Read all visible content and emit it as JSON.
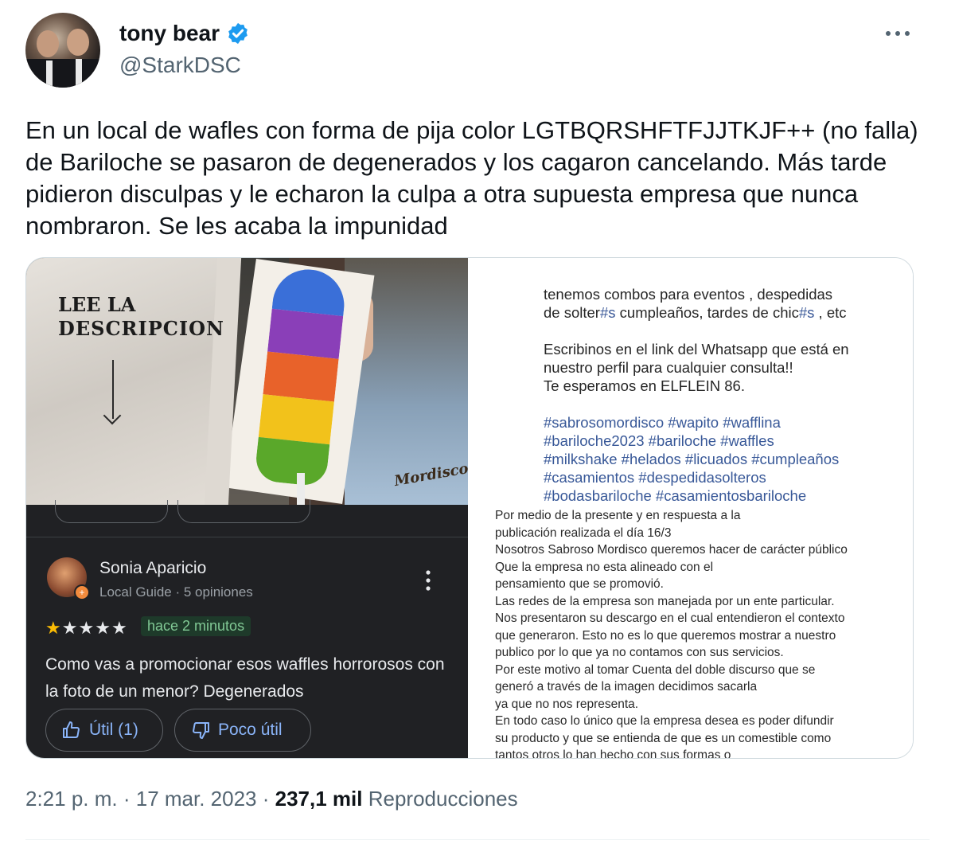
{
  "author": {
    "name": "tony bear",
    "handle": "@StarkDSC",
    "verified": true,
    "verified_color": "#1d9bf0"
  },
  "more_icon": "more-horizontal-icon",
  "tweet_text": "En un local de wafles con forma de pija color LGTBQRSHFTFJJTKJF++ (no falla) de Bariloche se pasaron de degenerados y los cagaron cancelando. Más tarde pidieron disculpas y le echaron la culpa a otra supuesta empresa que nunca nombraron. Se les acaba la impunidad",
  "photo": {
    "line1": "LEE LA",
    "line2": "DESCRIPCION",
    "brand": "Mordisco",
    "rainbow_colors": [
      "#3a6fd8",
      "#8a3fb8",
      "#e8622a",
      "#f2c21b",
      "#5aa82a"
    ]
  },
  "review": {
    "reviewer_name": "Sonia Aparicio",
    "reviewer_sub": "Local Guide · 5 opiniones",
    "stars_filled": 1,
    "stars_total": 5,
    "time": "hace 2 minutos",
    "text": "Como vas a promocionar esos waffles horrorosos con la foto de un menor? Degenerados",
    "useful_label": "Útil (1)",
    "not_useful_label": "Poco útil"
  },
  "post": {
    "line1": "tenemos combos para eventos , despedidas",
    "line2_a": "de solter",
    "line2_b": "#s",
    "line2_c": " cumpleaños, tardes de chic",
    "line2_d": "#s",
    "line2_e": " , etc",
    "line3": "Escribinos en el link del Whatsapp que está en",
    "line4": "nuestro perfil para cualquier consulta!!",
    "line5": "Te esperamos en ELFLEIN 86.",
    "tags": [
      "#sabrosomordisco #wapito #wafflina",
      "#bariloche2023 #bariloche #waffles",
      "#milkshake #helados #licuados #cumpleaños",
      "#casamientos #despedidasolteros",
      "#bodasbariloche #casamientosbariloche"
    ]
  },
  "letter_lines": [
    "Por medio de la presente y en respuesta a la",
    "publicación realizada el día 16/3",
    "Nosotros Sabroso Mordisco queremos hacer de carácter público",
    "Que la empresa no esta alineado con el",
    "pensamiento que se promovió.",
    "Las redes de la empresa son manejada por un ente particular.",
    "Nos presentaron su descargo en el cual entendieron el contexto",
    "que generaron. Esto no es lo que queremos mostrar a nuestro",
    "publico por lo que ya no contamos con sus servicios.",
    "Por este motivo al tomar Cuenta del doble discurso que se",
    "generó a través de la imagen decidimos sacarla",
    "ya que no nos representa.",
    "En todo caso lo único que la empresa desea es poder difundir",
    "su producto y que se entienda de que es un comestible como",
    "tantos otros lo han hecho con sus formas o"
  ],
  "footer": {
    "time": "2:21 p. m.",
    "sep": " · ",
    "date": "17 mar. 2023",
    "views_count": "237,1 mil",
    "views_label": "Reproducciones"
  }
}
